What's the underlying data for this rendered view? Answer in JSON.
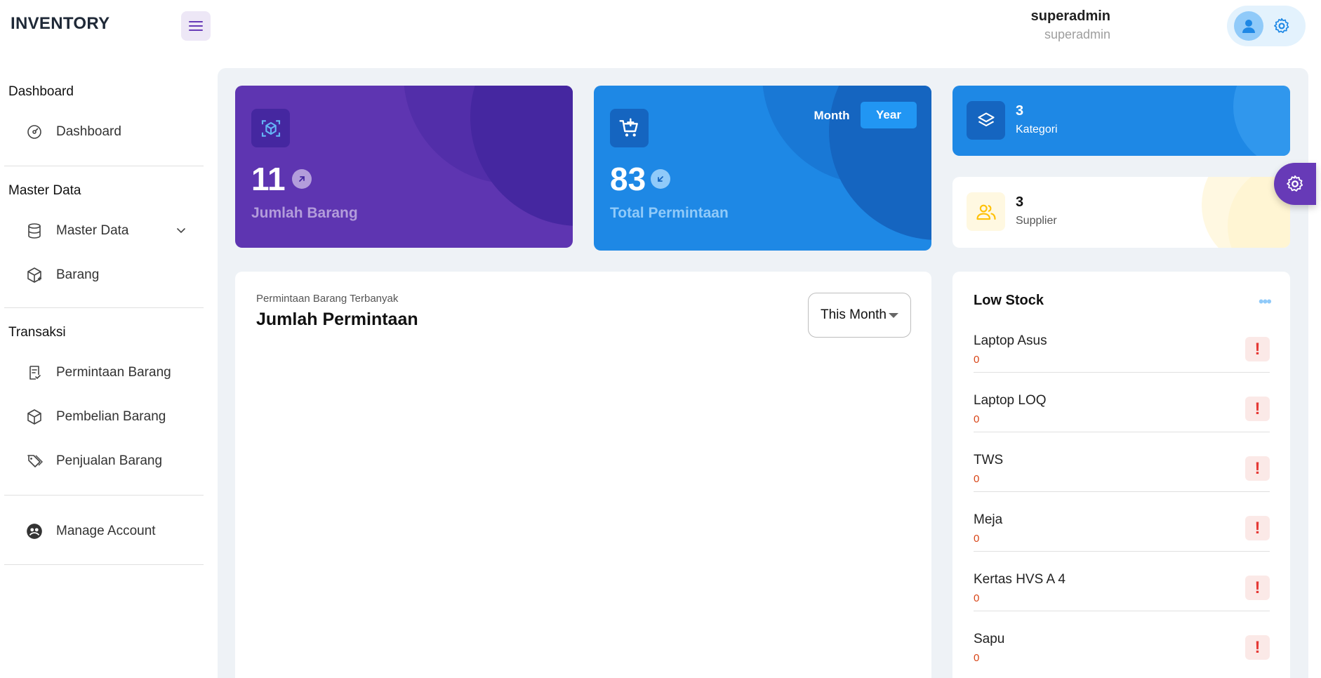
{
  "brand": "INVENTORY",
  "user": {
    "name": "superadmin",
    "role": "superadmin"
  },
  "sidebar": {
    "sections": [
      {
        "title": "Dashboard",
        "items": [
          {
            "label": "Dashboard",
            "icon": "dashboard-icon"
          }
        ]
      },
      {
        "title": "Master Data",
        "items": [
          {
            "label": "Master Data",
            "icon": "database-icon"
          },
          {
            "label": "Barang",
            "icon": "package-icon"
          }
        ]
      },
      {
        "title": "Transaksi",
        "items": [
          {
            "label": "Permintaan Barang",
            "icon": "file-check-icon"
          },
          {
            "label": "Pembelian Barang",
            "icon": "box-icon"
          },
          {
            "label": "Penjualan Barang",
            "icon": "tags-icon"
          }
        ]
      }
    ],
    "account": {
      "label": "Manage Account",
      "icon": "user-circle-icon"
    }
  },
  "cards": {
    "barang": {
      "value": "11",
      "label": "Jumlah Barang"
    },
    "permintaan": {
      "value": "83",
      "label": "Total Permintaan",
      "toggle_month": "Month",
      "toggle_year": "Year"
    },
    "kategori": {
      "value": "3",
      "label": "Kategori"
    },
    "supplier": {
      "value": "3",
      "label": "Supplier"
    }
  },
  "chart": {
    "subtitle": "Permintaan Barang Terbanyak",
    "title": "Jumlah Permintaan",
    "period": "This Month"
  },
  "low_stock": {
    "title": "Low Stock",
    "items": [
      {
        "name": "Laptop Asus",
        "qty": "0"
      },
      {
        "name": "Laptop LOQ",
        "qty": "0"
      },
      {
        "name": "TWS",
        "qty": "0"
      },
      {
        "name": "Meja",
        "qty": "0"
      },
      {
        "name": "Kertas HVS A 4",
        "qty": "0"
      },
      {
        "name": "Sapu",
        "qty": "0"
      }
    ]
  },
  "colors": {
    "purple": "#5e35b1",
    "blue": "#1e88e5",
    "warning": "#e53935"
  }
}
